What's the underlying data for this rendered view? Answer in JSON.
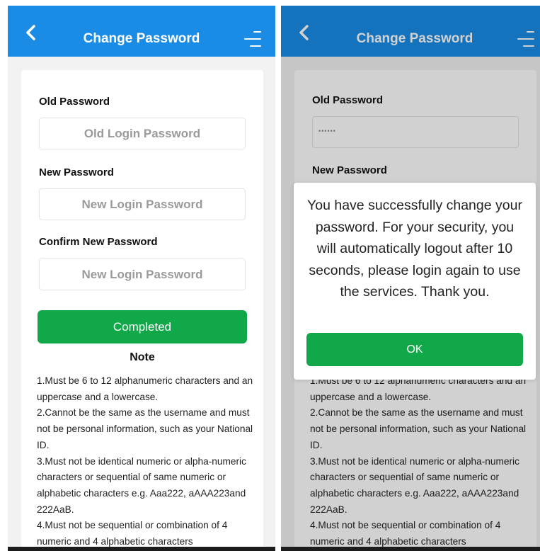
{
  "header": {
    "title": "Change Password",
    "back_icon": "chevron-left-icon",
    "menu_icon": "menu-icon"
  },
  "form": {
    "old_label": "Old Password",
    "old_placeholder": "Old Login Password",
    "old_value_masked": "••••••",
    "new_label": "New Password",
    "new_placeholder": "New Login Password",
    "confirm_label": "Confirm New Password",
    "confirm_placeholder": "New Login Password",
    "submit_label": "Completed"
  },
  "note": {
    "title": "Note",
    "text": "1.Must be 6 to 12 alphanumeric characters and an uppercase and a lowercase.\n2.Cannot be the same as the username and must not be personal information, such as your National ID.\n3.Must not be identical numeric or alpha-numeric characters or sequential of same numeric or alphabetic characters e.g. Aaa222, aAAA223and 222AaB.\n4.Must not be sequential or combination of 4 numeric and 4 alphabetic characters"
  },
  "dialog": {
    "message": "You have successfully change your password. For your security, you will automatically logout after 10 seconds, please login again to use the services. Thank you.",
    "ok_label": "OK"
  },
  "colors": {
    "header": "#1a8ce6",
    "button": "#11a84a",
    "background": "#f2f2f2"
  }
}
